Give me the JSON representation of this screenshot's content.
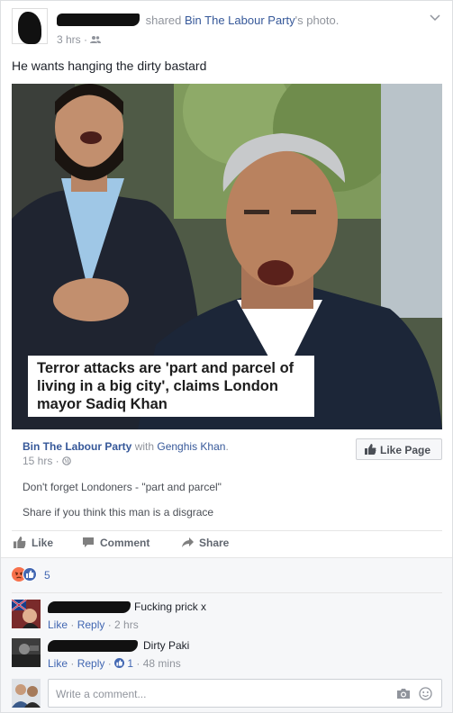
{
  "post": {
    "shared_word": "shared",
    "page_name": "Bin The Labour Party",
    "photo_suffix": "'s photo.",
    "time": "3 hrs · ",
    "status": "He wants hanging the dirty bastard"
  },
  "photo": {
    "headline_lines": [
      "Terror attacks are 'part and parcel of",
      "living in a big city', claims London",
      "mayor Sadiq Khan"
    ]
  },
  "attachment": {
    "page_name": "Bin The Labour Party",
    "with_text": " with ",
    "with_name": "Genghis Khan",
    "with_suffix": ".",
    "time": "15 hrs · ",
    "like_page_label": "Like Page",
    "text1": "Don't forget Londoners - \"part and parcel\"",
    "text2": "Share if you think this man is a disgrace"
  },
  "actions": {
    "like": "Like",
    "comment": "Comment",
    "share": "Share"
  },
  "reactions": {
    "count": "5"
  },
  "comments": [
    {
      "text": "Fucking prick x",
      "like": "Like",
      "reply": "Reply",
      "time": "2 hrs"
    },
    {
      "text": "Dirty Paki",
      "like": "Like",
      "reply": "Reply",
      "likes": "1",
      "time": "48 mins"
    }
  ],
  "composer": {
    "placeholder": "Write a comment..."
  },
  "colors": {
    "link": "#365899",
    "accent": "#4267b2",
    "muted": "#90949c"
  }
}
